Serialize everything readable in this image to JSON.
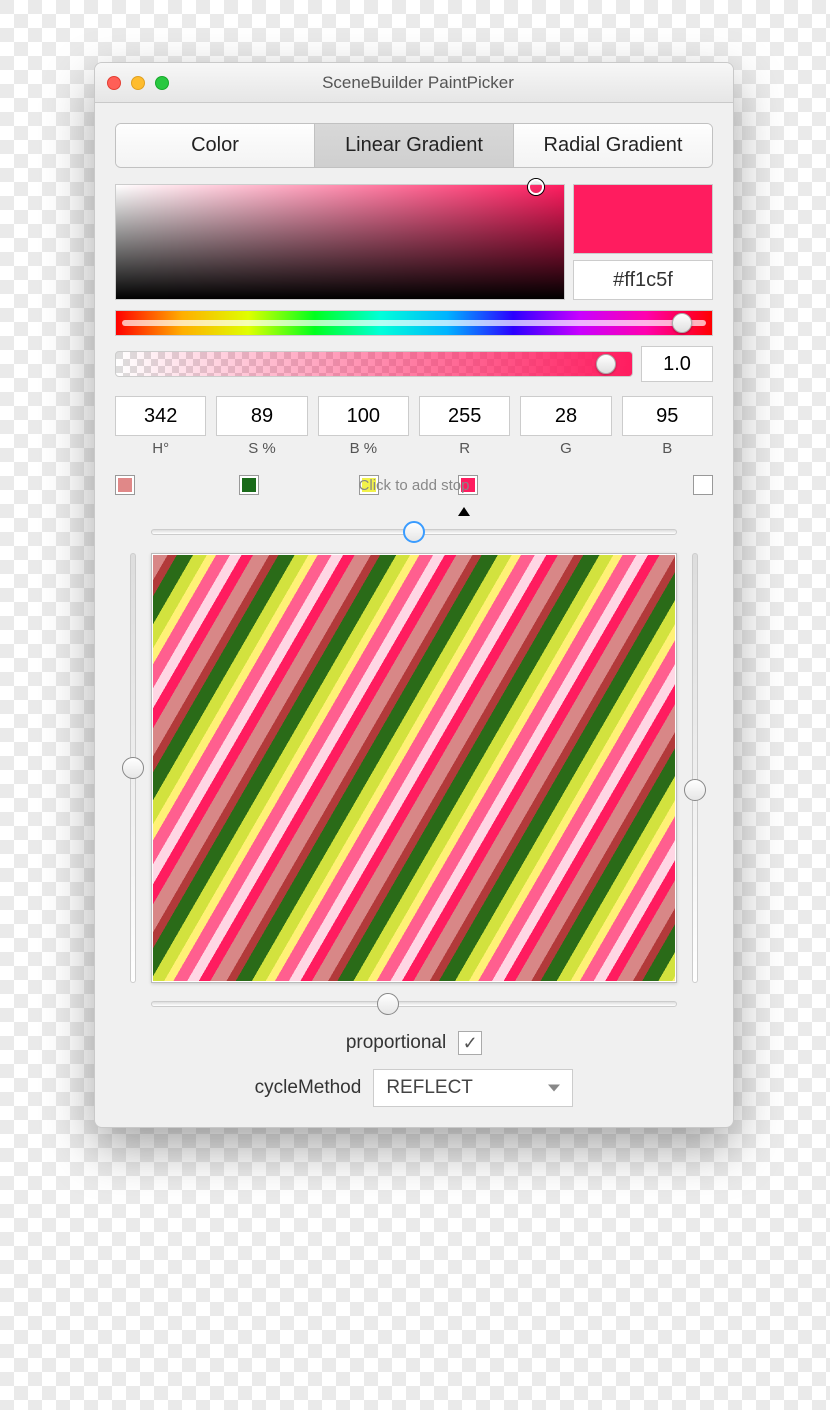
{
  "window": {
    "title": "SceneBuilder PaintPicker"
  },
  "tabs": {
    "color": "Color",
    "linear": "Linear Gradient",
    "radial": "Radial Gradient",
    "active": "linear"
  },
  "color": {
    "hex": "#ff1c5f",
    "alpha": "1.0",
    "hsb": {
      "h": "342",
      "s": "89",
      "b": "100"
    },
    "rgb": {
      "r": "255",
      "g": "28",
      "b": "95"
    },
    "labels": {
      "h": "H°",
      "s": "S %",
      "b": "B %",
      "r": "R",
      "g": "G",
      "bb": "B"
    }
  },
  "stops": {
    "hint": "Click to add stop",
    "colors": [
      "#e08888",
      "#1a6b1a",
      "#f2f24a",
      "#ff1c5f",
      "#ffffff"
    ]
  },
  "proportional": {
    "label": "proportional",
    "checked": true
  },
  "cycleMethod": {
    "label": "cycleMethod",
    "value": "REFLECT"
  }
}
